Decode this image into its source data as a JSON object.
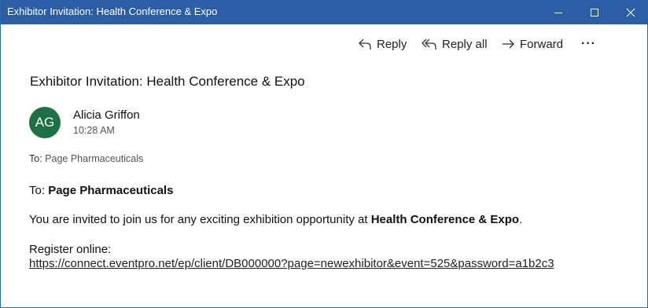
{
  "window": {
    "title": "Exhibitor Invitation: Health Conference & Expo",
    "titlebar_color": "#2b5ea4",
    "controls": [
      "minimize-icon",
      "maximize-icon",
      "close-icon"
    ]
  },
  "toolbar": {
    "reply_label": "Reply",
    "reply_all_label": "Reply all",
    "forward_label": "Forward",
    "more_label": "···"
  },
  "message": {
    "subject": "Exhibitor Invitation: Health Conference & Expo",
    "avatar_initials": "AG",
    "avatar_color": "#1e7145",
    "sender": "Alicia Griffon",
    "time": "10:28 AM",
    "to_prefix": "To:",
    "to_value": "Page Pharmaceuticals"
  },
  "body": {
    "to_prefix": "To:",
    "to_name": "Page Pharmaceuticals",
    "invite_text": "You are invited to join us for any exciting exhibition opportunity at",
    "event_name": "Health Conference & Expo",
    "invite_end": ".",
    "register_label": "Register online:",
    "link": "https://connect.eventpro.net/ep/client/DB000000?page=newexhibitor&event=525&password=a1b2c3"
  }
}
